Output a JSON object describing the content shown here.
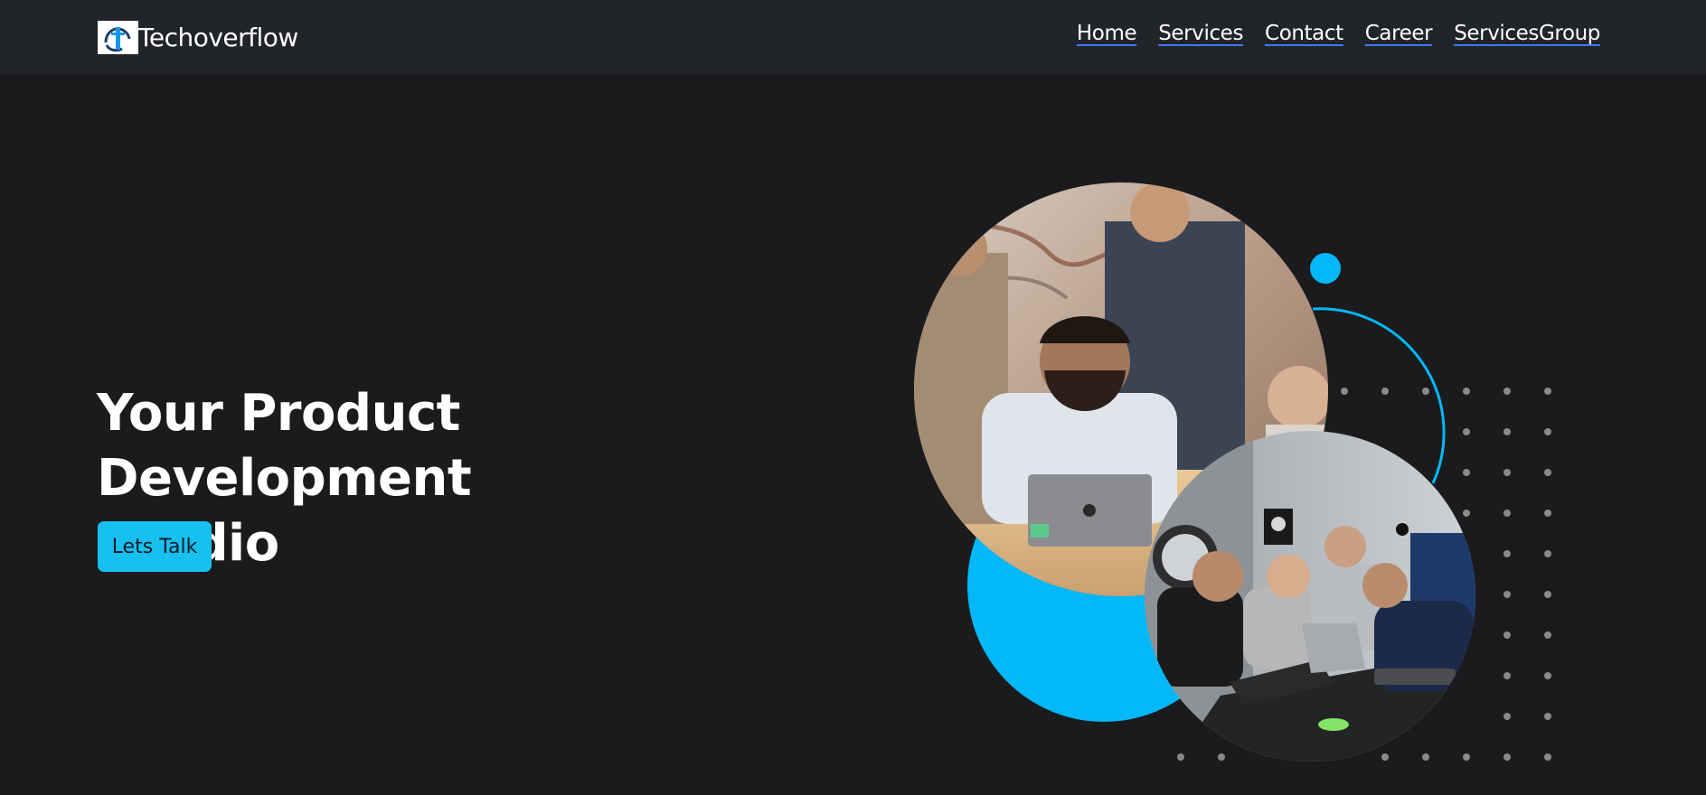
{
  "navbar": {
    "brand_name": "Techoverflow",
    "links": [
      {
        "label": "Home"
      },
      {
        "label": "Services"
      },
      {
        "label": "Contact"
      },
      {
        "label": "Career"
      },
      {
        "label": "ServicesGroup"
      }
    ]
  },
  "hero": {
    "title_line1": "Your Product Development",
    "title_line2": "Studio",
    "cta_label": "Lets Talk"
  },
  "colors": {
    "page_bg": "#1b1b1d",
    "navbar_bg": "#212429",
    "accent": "#03b8f8",
    "button_bg": "#16c1ef",
    "link_underline": "#3d7bfd",
    "dots": "#8a8a8a"
  },
  "icons": {
    "brand_logo": "techoverflow-logo-icon"
  },
  "images": {
    "photo_top": "team-at-laptop-photo",
    "photo_bottom": "team-meeting-photo"
  }
}
